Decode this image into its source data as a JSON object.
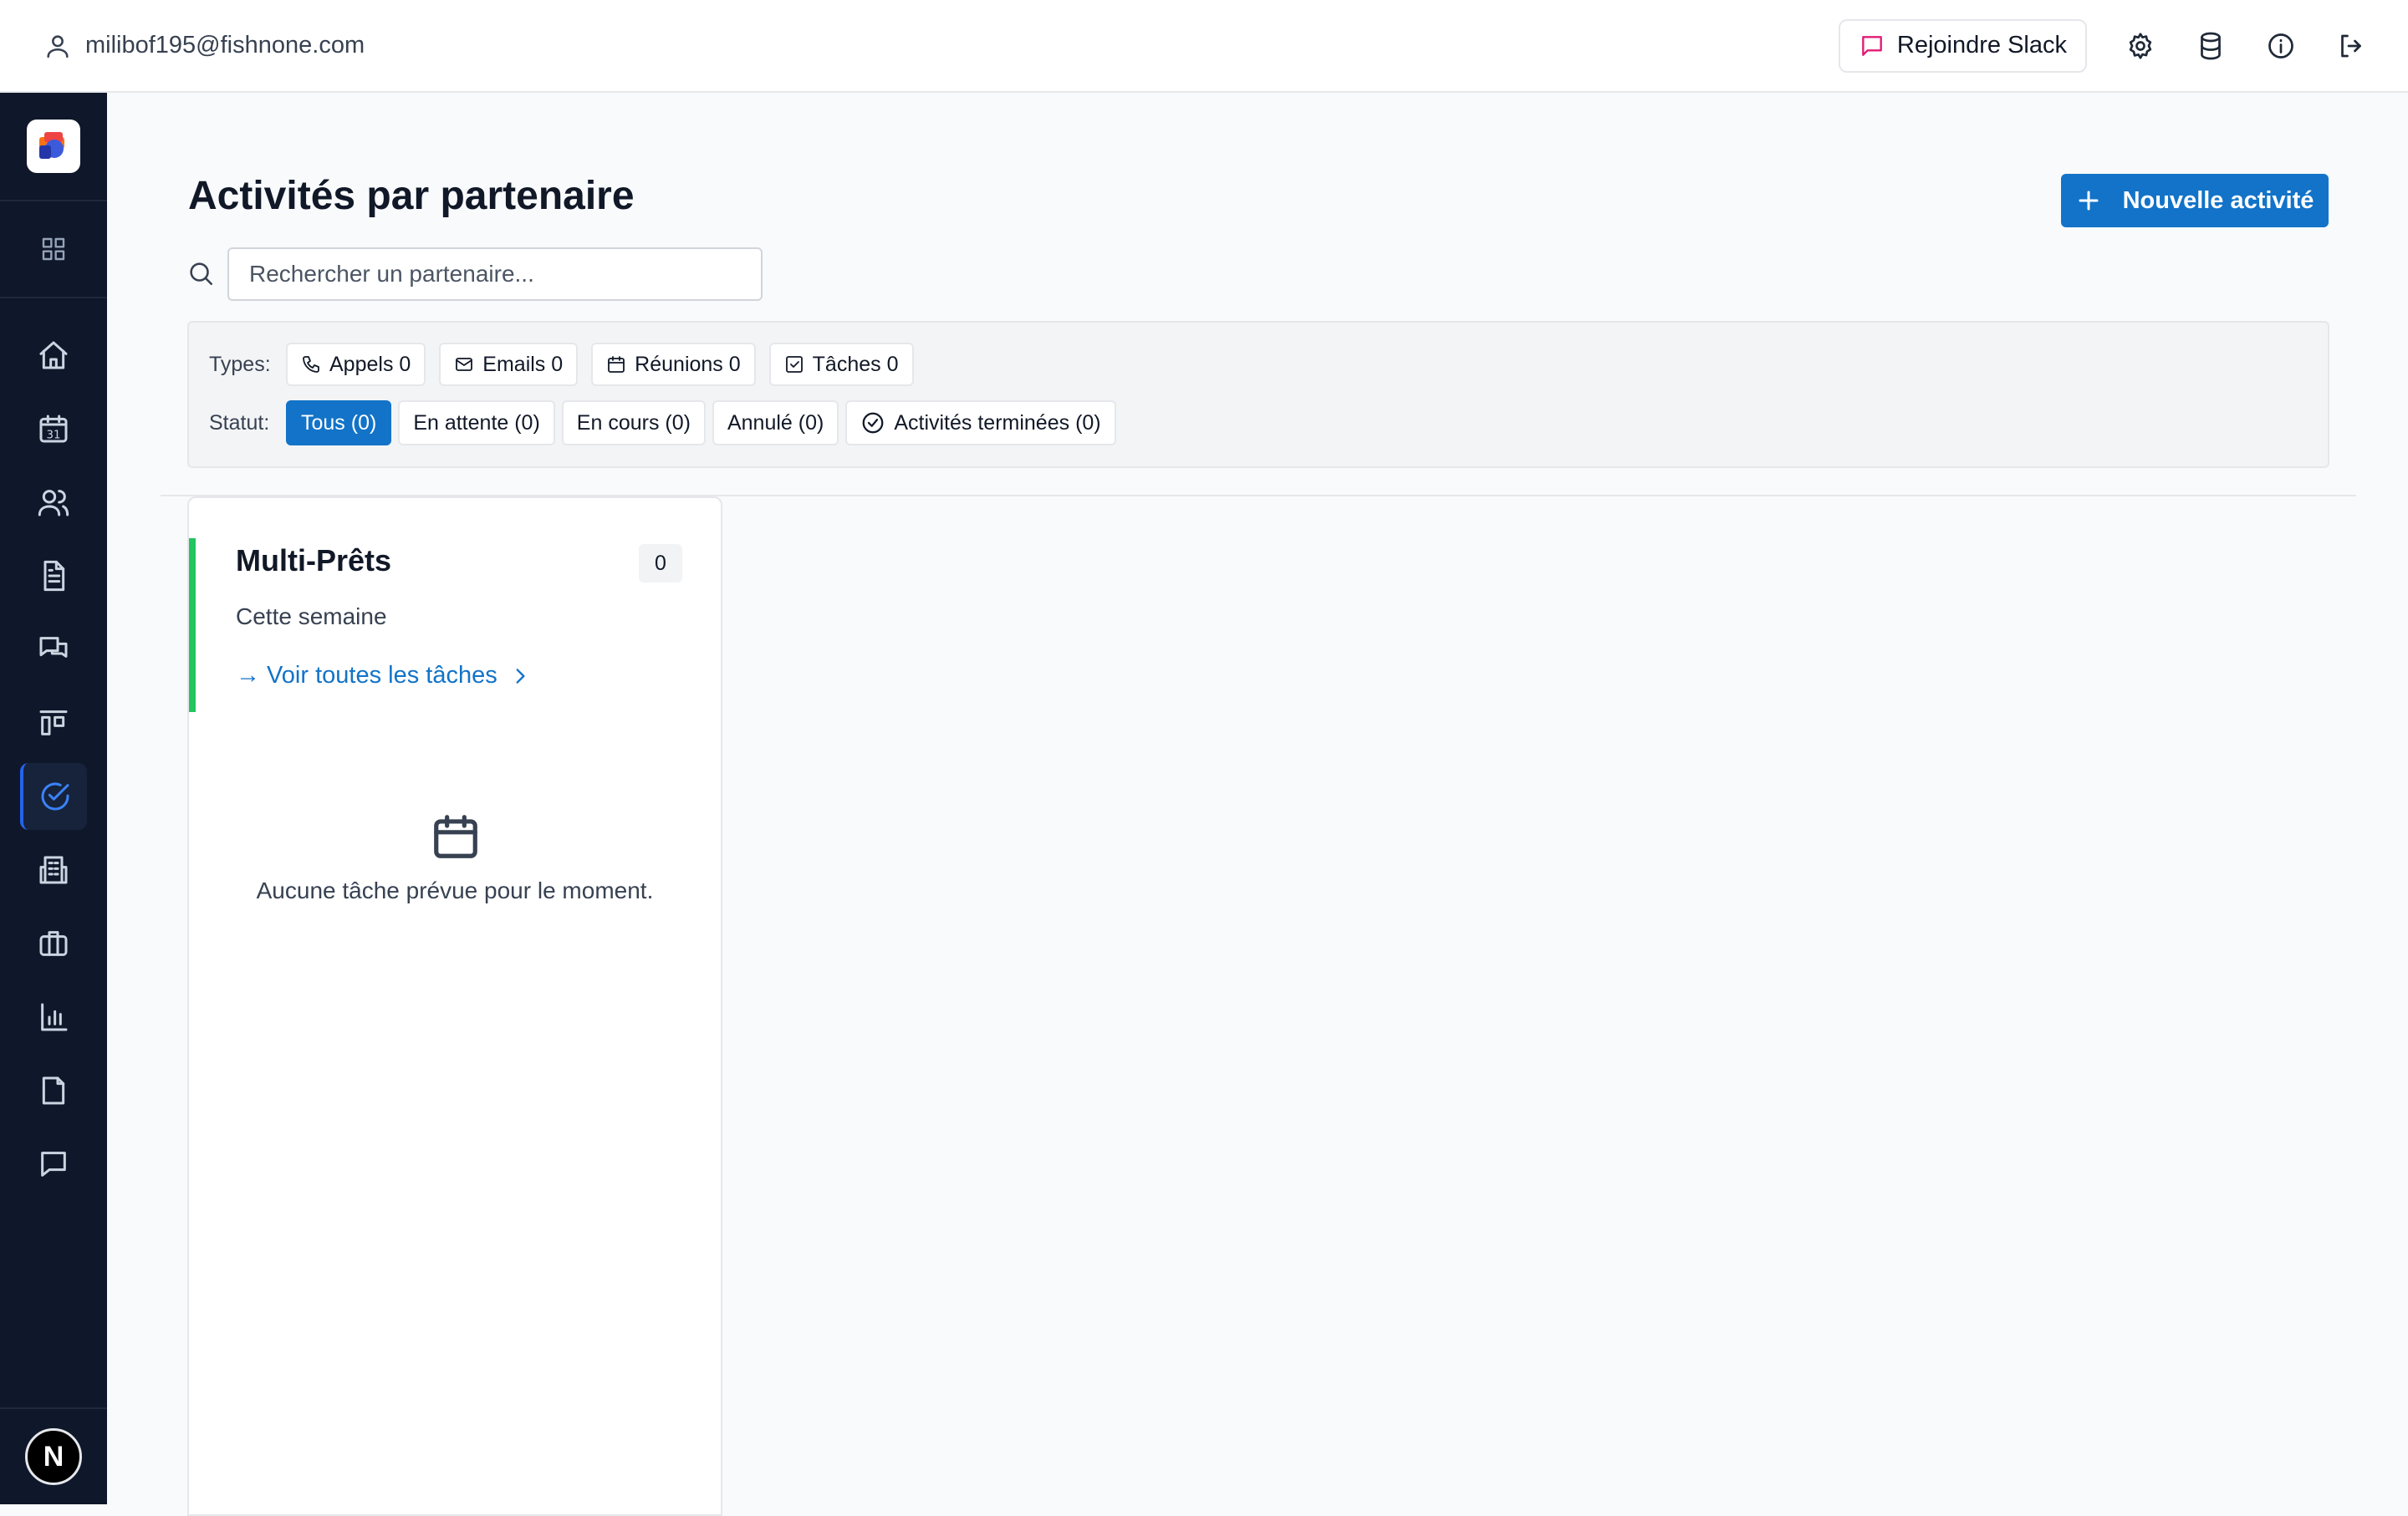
{
  "header": {
    "user_email": "milibof195@fishnone.com",
    "slack_label": "Rejoindre Slack",
    "icons": [
      "user-icon",
      "chat-icon",
      "settings-icon",
      "database-icon",
      "info-icon",
      "logout-icon"
    ]
  },
  "sidebar": {
    "items": [
      {
        "name": "home-icon"
      },
      {
        "name": "calendar-icon",
        "day": "31"
      },
      {
        "name": "users-icon"
      },
      {
        "name": "document-icon"
      },
      {
        "name": "messages-icon"
      },
      {
        "name": "kanban-icon"
      },
      {
        "name": "tasks-icon",
        "active": true
      },
      {
        "name": "building-icon"
      },
      {
        "name": "briefcase-icon"
      },
      {
        "name": "chart-icon"
      },
      {
        "name": "file-icon"
      },
      {
        "name": "comment-icon"
      }
    ],
    "avatar_initial": "N",
    "accent_color": "#2563eb"
  },
  "main": {
    "title": "Activités par partenaire",
    "new_button": "Nouvelle activité",
    "search_placeholder": "Rechercher un partenaire...",
    "filters": {
      "types_label": "Types:",
      "types": [
        {
          "label": "Appels 0",
          "icon": "phone-icon"
        },
        {
          "label": "Emails 0",
          "icon": "mail-icon"
        },
        {
          "label": "Réunions 0",
          "icon": "calendar-icon"
        },
        {
          "label": "Tâches 0",
          "icon": "checkbox-icon"
        }
      ],
      "status_label": "Statut:",
      "statuses": [
        {
          "label": "Tous (0)",
          "active": true
        },
        {
          "label": "En attente (0)"
        },
        {
          "label": "En cours (0)"
        },
        {
          "label": "Annulé (0)"
        },
        {
          "label": "Activités terminées (0)",
          "icon": "check-circle-icon"
        }
      ]
    },
    "card": {
      "partner": "Multi-Prêts",
      "count": "0",
      "period": "Cette semaine",
      "link": "→ Voir toutes les tâches",
      "empty_message": "Aucune tâche prévue pour le moment.",
      "accent_color": "#22c55e"
    },
    "primary_color": "#1273c8"
  }
}
